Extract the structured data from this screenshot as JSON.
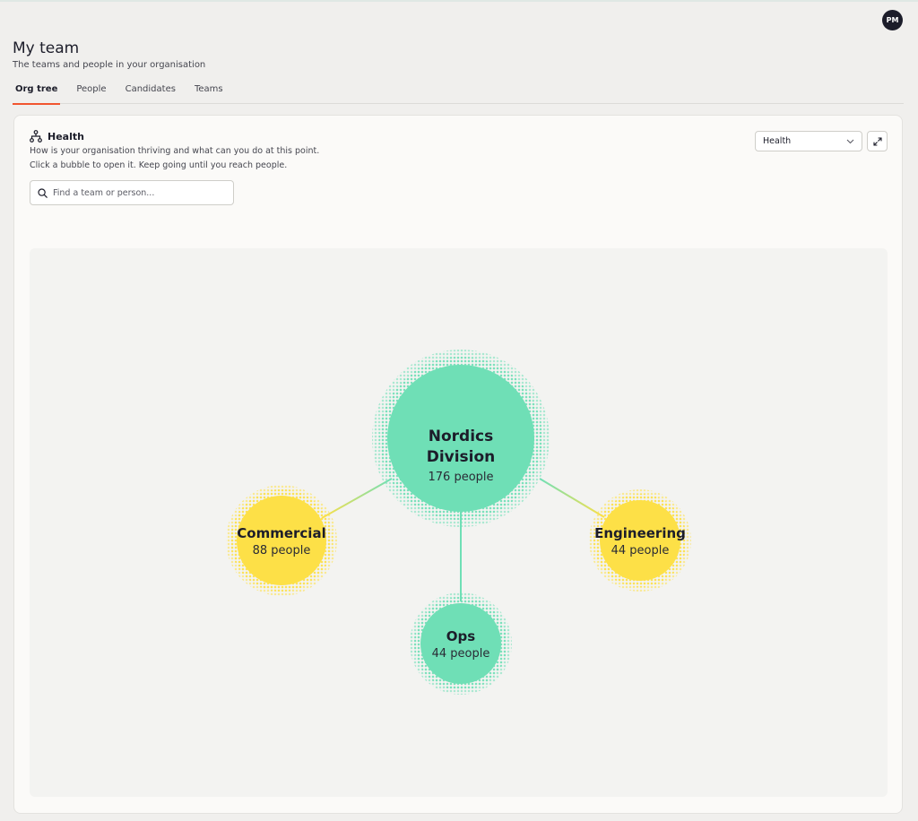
{
  "user": {
    "initials": "PM"
  },
  "header": {
    "title": "My team",
    "subtitle": "The teams and people in your organisation"
  },
  "tabs": [
    {
      "label": "Org tree",
      "active": true
    },
    {
      "label": "People",
      "active": false
    },
    {
      "label": "Candidates",
      "active": false
    },
    {
      "label": "Teams",
      "active": false
    }
  ],
  "card": {
    "icon": "org-tree-icon",
    "title": "Health",
    "description_1": "How is your organisation thriving and what can you do at this point.",
    "description_2": "Click a bubble to open it. Keep going until you reach people.",
    "search": {
      "placeholder": "Find a team or person...",
      "value": ""
    },
    "view_select": {
      "value": "Health"
    }
  },
  "org": {
    "root": {
      "name_line1": "Nordics",
      "name_line2": "Division",
      "count": "176 people",
      "color": "#6fdfb6"
    },
    "children": [
      {
        "name": "Commercial",
        "count": "88 people",
        "color": "#fde047"
      },
      {
        "name": "Engineering",
        "count": "44 people",
        "color": "#fde047"
      },
      {
        "name": "Ops",
        "count": "44 people",
        "color": "#6fdfb6"
      }
    ]
  },
  "colors": {
    "accent": "#f1552f",
    "healthy": "#6fdfb6",
    "warning": "#fde047"
  }
}
